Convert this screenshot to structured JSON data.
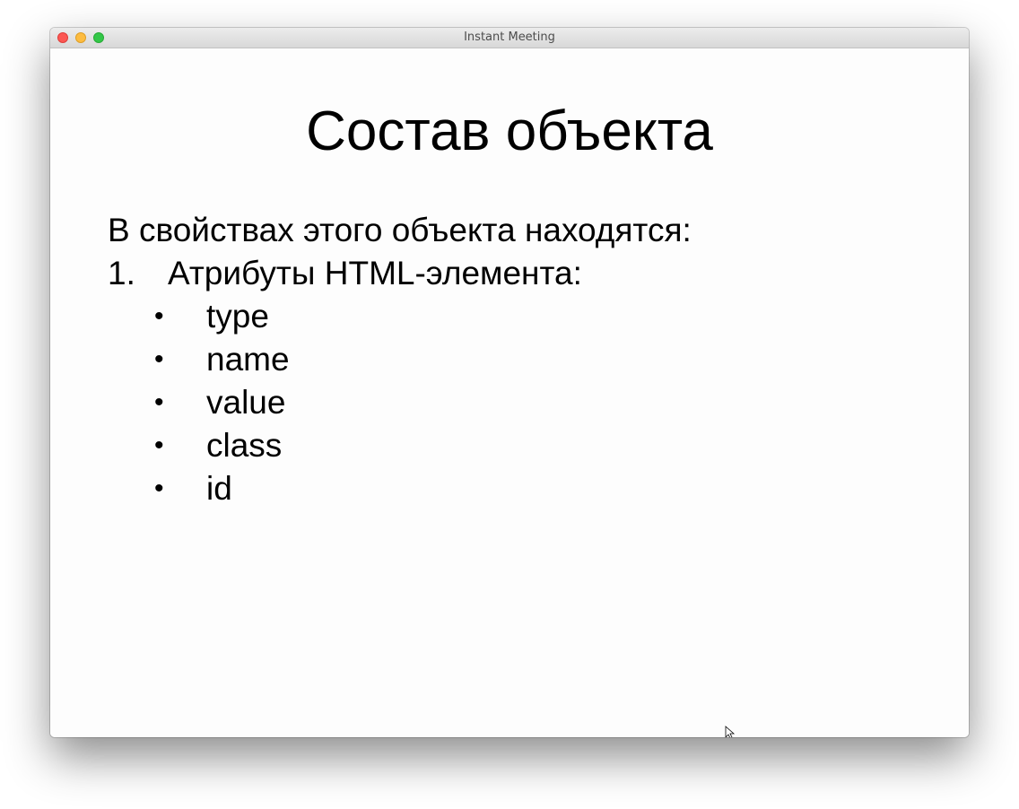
{
  "window": {
    "title": "Instant Meeting"
  },
  "slide": {
    "title": "Состав объекта",
    "intro": "В свойствах этого объекта находятся:",
    "numbered_item": {
      "number": "1.",
      "text": "Атрибуты HTML-элемента:"
    },
    "bullet_symbol": "•",
    "bullets": [
      "type",
      "name",
      "value",
      "class",
      "id"
    ]
  },
  "colors": {
    "slide_background": "#fdfdfd",
    "text": "#000000",
    "close": "#fc5753",
    "minimize": "#fdbc40",
    "maximize": "#33c748"
  },
  "icons": [
    "close-button-icon",
    "minimize-button-icon",
    "maximize-button-icon",
    "mouse-pointer-icon"
  ]
}
